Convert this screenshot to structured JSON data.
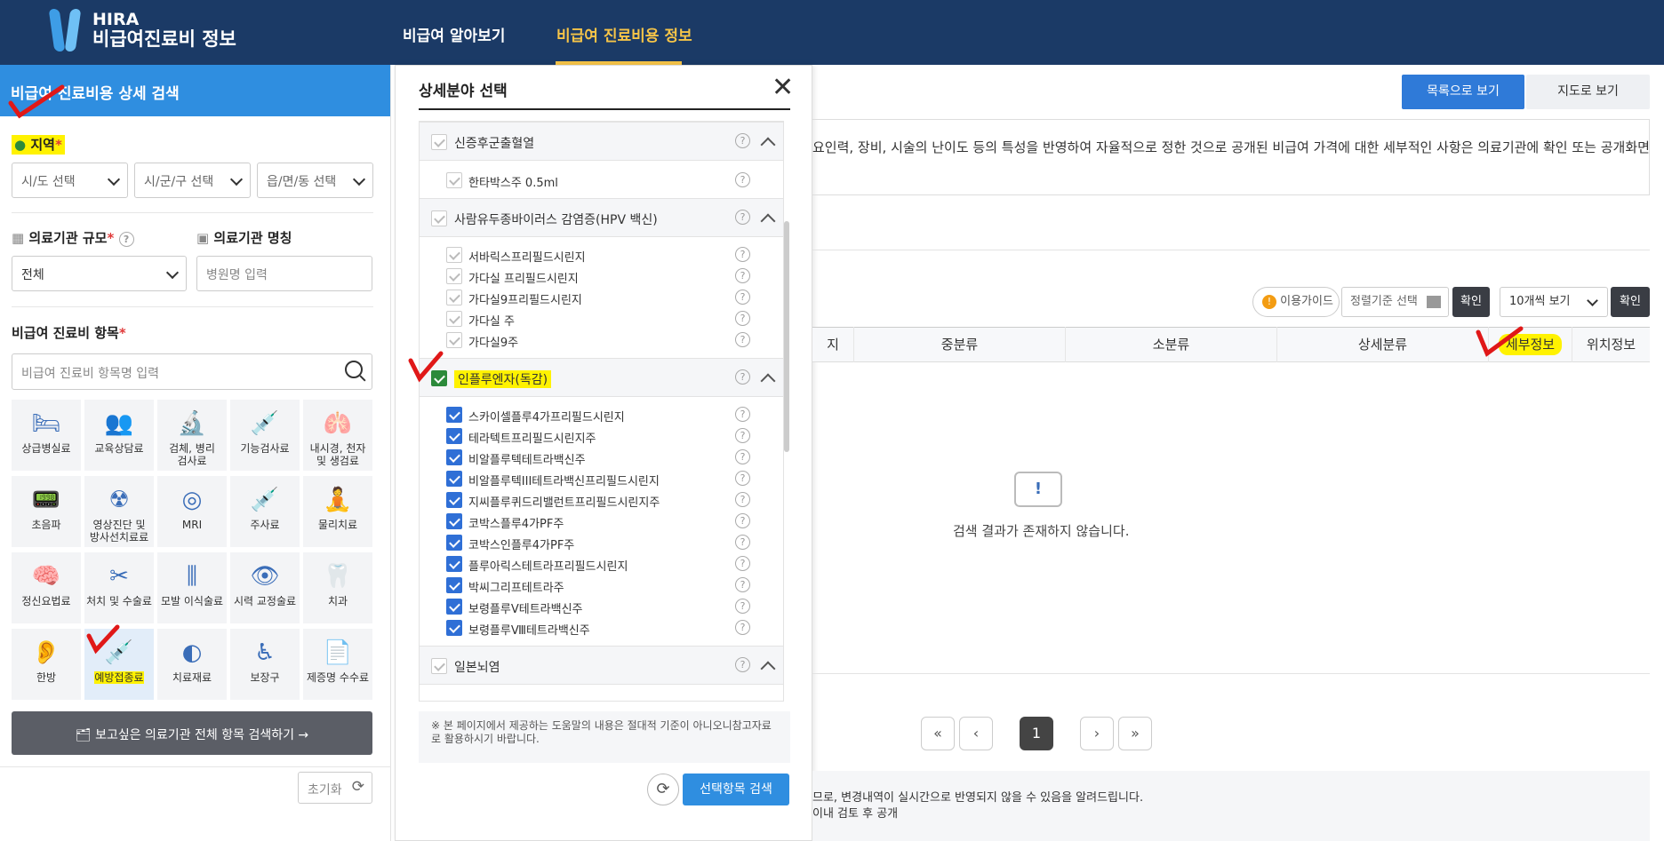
{
  "header": {
    "logo_line1": "HIRA",
    "logo_line2": "비급여진료비 정보",
    "nav": [
      "비급여 알아보기",
      "비급여 진료비용 정보"
    ]
  },
  "left": {
    "title": "비급여 진료비용 상세 검색",
    "region_label": "지역",
    "region_selects": [
      "시/도 선택",
      "시/군/구 선택",
      "읍/면/동 선택"
    ],
    "scale_label": "의료기관 규모",
    "scale_value": "전체",
    "name_label": "의료기관 명칭",
    "name_placeholder": "병원명 입력",
    "items_label": "비급여 진료비 항목",
    "items_placeholder": "비급여 진료비 항목명 입력",
    "categories": [
      [
        "상급병실료"
      ],
      [
        "교육상담료"
      ],
      [
        "검체, 병리",
        "검사료"
      ],
      [
        "기능검사료"
      ],
      [
        "내시경, 천자",
        "및 생검료"
      ],
      [
        "초음파"
      ],
      [
        "영상진단 및",
        "방사선치료료"
      ],
      [
        "MRI"
      ],
      [
        "주사료"
      ],
      [
        "물리치료"
      ],
      [
        "정신요법료"
      ],
      [
        "처치 및 수술료"
      ],
      [
        "모발 이식술료"
      ],
      [
        "시력 교정술료"
      ],
      [
        "치과"
      ],
      [
        "한방"
      ],
      [
        "예방접종료"
      ],
      [
        "치료재료"
      ],
      [
        "보장구"
      ],
      [
        "제증명 수수료"
      ]
    ],
    "all_search_button": "보고싶은 의료기관 전체 항목 검색하기",
    "reset_button": "초기화"
  },
  "modal": {
    "title": "상세분야 선택",
    "groups": [
      {
        "label": "신증후군출혈열",
        "checked": false,
        "items": [
          {
            "label": "한타박스주 0.5ml",
            "checked": false
          }
        ]
      },
      {
        "label": "사람유두종바이러스 감염증(HPV 백신)",
        "checked": false,
        "items": [
          {
            "label": "서바릭스프리필드시린지",
            "checked": false
          },
          {
            "label": "가다실 프리필드시린지",
            "checked": false
          },
          {
            "label": "가다실9프리필드시린지",
            "checked": false
          },
          {
            "label": "가다실 주",
            "checked": false
          },
          {
            "label": "가다실9주",
            "checked": false
          }
        ]
      },
      {
        "label": "인플루엔자(독감)",
        "checked": true,
        "items": [
          {
            "label": "스카이셀플루4가프리필드시린지",
            "checked": true
          },
          {
            "label": "테라텍트프리필드시린지주",
            "checked": true
          },
          {
            "label": "비알플루텍테트라백신주",
            "checked": true
          },
          {
            "label": "비알플루텍III테트라백신프리필드시린지",
            "checked": true
          },
          {
            "label": "지씨플루퀴드리밸런트프리필드시린지주",
            "checked": true
          },
          {
            "label": "코박스플루4가PF주",
            "checked": true
          },
          {
            "label": "코박스인플루4가PF주",
            "checked": true
          },
          {
            "label": "플루아릭스테트라프리필드시린지",
            "checked": true
          },
          {
            "label": "박씨그리프테트라주",
            "checked": true
          },
          {
            "label": "보령플루Ⅴ테트라백신주",
            "checked": true
          },
          {
            "label": "보령플루Ⅷ테트라백신주",
            "checked": true
          }
        ]
      },
      {
        "label": "일본뇌염",
        "checked": false,
        "items": []
      }
    ],
    "note": "※ 본 페이지에서 제공하는 도움말의 내용은 절대적 기준이 아니오니참고자료로 활용하시기 바랍니다.",
    "search_button": "선택항목 검색"
  },
  "main": {
    "view_list": "목록으로 보기",
    "view_map": "지도로 보기",
    "info_text": "요인력, 장비, 시술의 난이도 등의 특성을 반영하여 자율적으로 정한 것으로 공개된 비급여 가격에 대한 세부적인 사항은 의료기관에 확인 또는 공개화면'세부",
    "guide_button": "이용가이드",
    "sort_select": "정렬기준 선택",
    "confirm1": "확인",
    "page_size": "10개씩 보기",
    "confirm2": "확인",
    "columns": [
      "지",
      "중분류",
      "소분류",
      "상세분류",
      "세부정보",
      "위치정보"
    ],
    "empty_message": "검색 결과가 존재하지 않습니다.",
    "current_page": "1",
    "footer_line1": "므로, 변경내역이 실시간으로 반영되지 않을 수 있음을 알려드립니다.",
    "footer_line2": "이내 검토 후 공개"
  },
  "colors": {
    "header_bg": "#1b3a66",
    "accent": "#2f8ee0",
    "nav_active": "#f7c548",
    "highlight": "#fff200",
    "annotation_red": "#e01818"
  }
}
